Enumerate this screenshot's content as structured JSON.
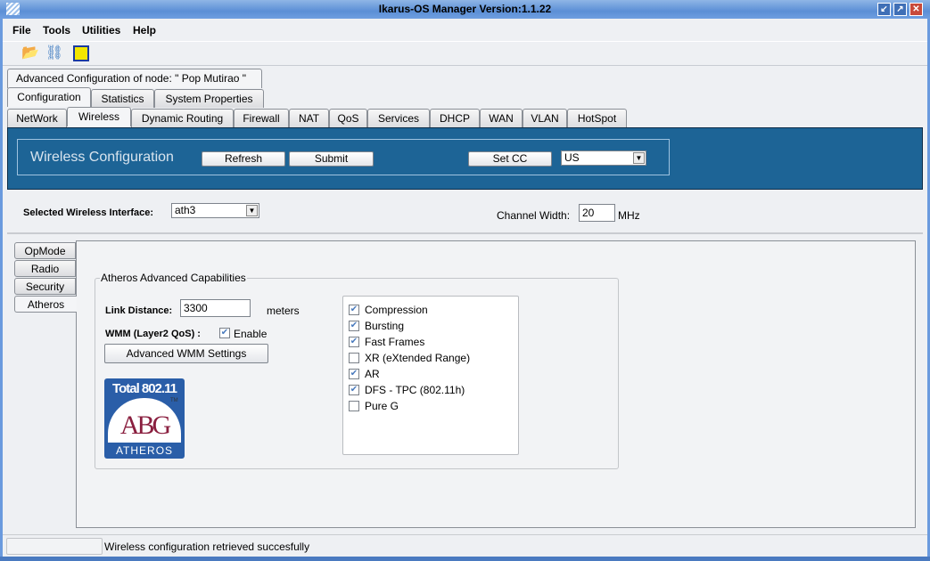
{
  "window": {
    "title": "Ikarus-OS Manager   Version:1.1.22"
  },
  "menu": [
    "File",
    "Tools",
    "Utilities",
    "Help"
  ],
  "node_label": "Advanced Configuration of node:  \" Pop Mutirao \"",
  "main_tabs": [
    "Configuration",
    "Statistics",
    "System Properties"
  ],
  "sub_tabs": [
    "NetWork",
    "Wireless",
    "Dynamic Routing",
    "Firewall",
    "NAT",
    "QoS",
    "Services",
    "DHCP",
    "WAN",
    "VLAN",
    "HotSpot"
  ],
  "header": {
    "title": "Wireless Configuration",
    "refresh": "Refresh",
    "submit": "Submit",
    "set_cc": "Set CC",
    "country": "US"
  },
  "interface": {
    "label": "Selected Wireless Interface:",
    "value": "ath3",
    "channel_label": "Channel Width:",
    "channel_value": "20",
    "channel_unit": "MHz"
  },
  "side_tabs": [
    "OpMode",
    "Radio",
    "Security",
    "Atheros"
  ],
  "atheros": {
    "legend": "Atheros Advanced Capabilities",
    "link_label": "Link Distance:",
    "link_value": "3300",
    "link_unit": "meters",
    "wmm_label": "WMM (Layer2 QoS) :",
    "wmm_enable": "Enable",
    "wmm_checked": true,
    "wmm_button": "Advanced WMM Settings",
    "logo": {
      "line1": "Total 802.11",
      "tm": "TM",
      "abg": "ABG",
      "brand": "ATHEROS"
    },
    "capabilities": [
      {
        "label": "Compression",
        "checked": true
      },
      {
        "label": "Bursting",
        "checked": true
      },
      {
        "label": "Fast Frames",
        "checked": true
      },
      {
        "label": "XR (eXtended Range)",
        "checked": false
      },
      {
        "label": "AR",
        "checked": true
      },
      {
        "label": "DFS - TPC (802.11h)",
        "checked": true
      },
      {
        "label": "Pure G",
        "checked": false
      }
    ]
  },
  "status": "Wireless configuration retrieved succesfully",
  "colors": {
    "panel": "#1d6496",
    "titlebar": "#5b8fd6"
  }
}
